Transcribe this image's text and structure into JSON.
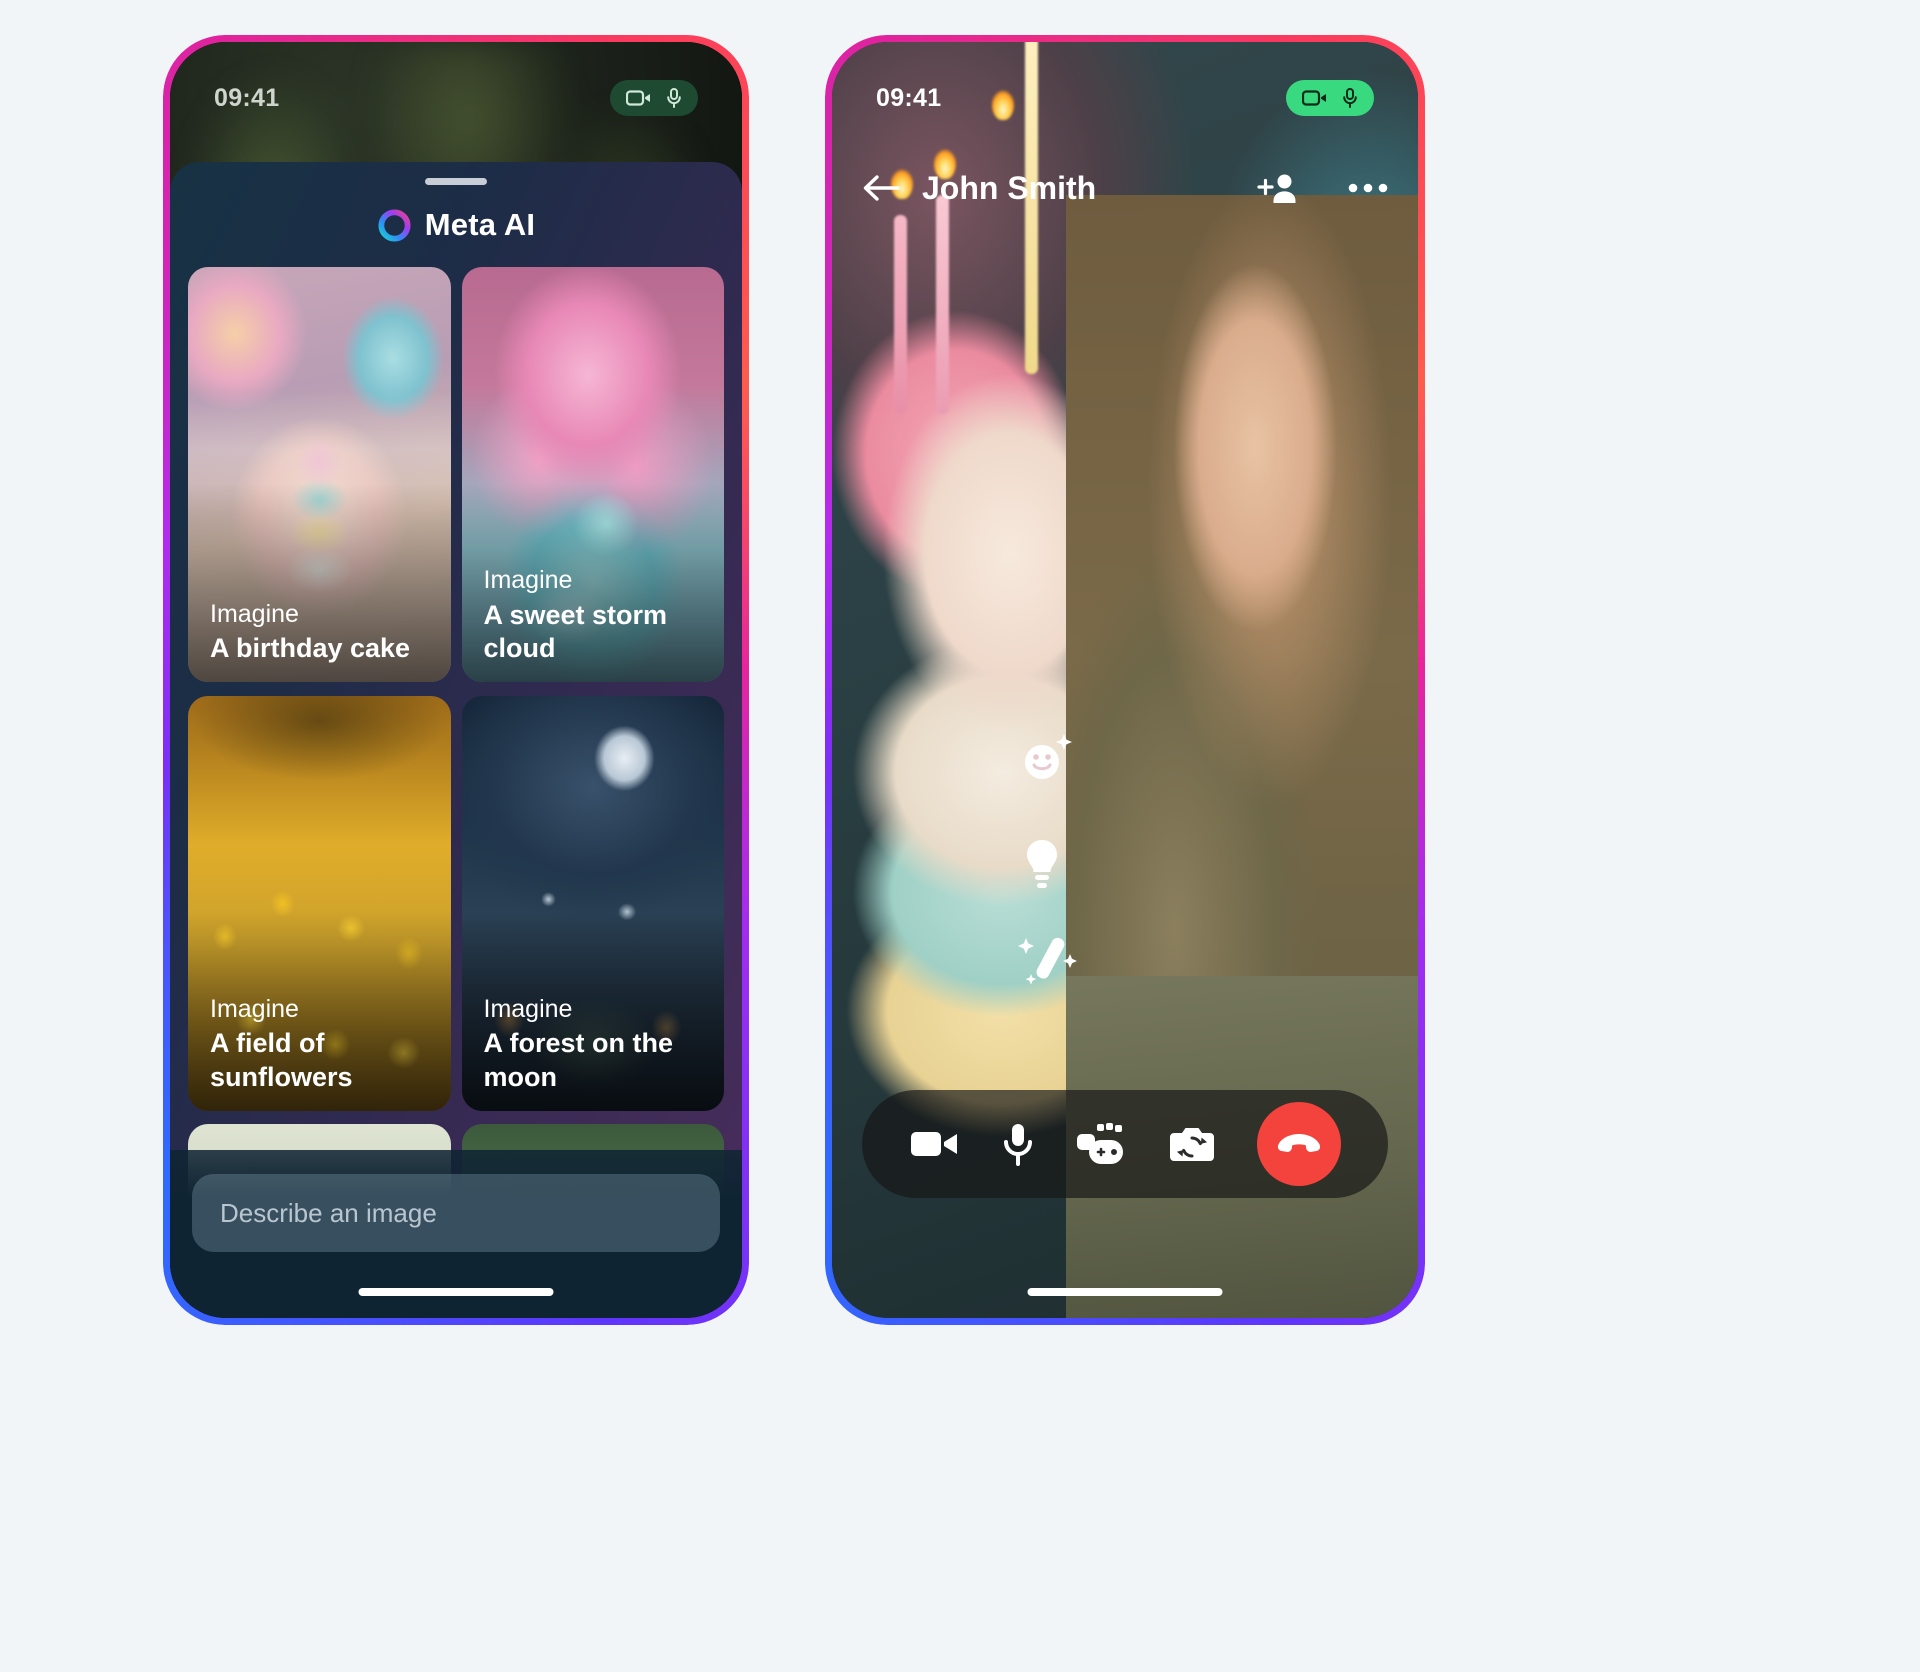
{
  "left_phone": {
    "status_bar": {
      "clock": "09:41",
      "recording_pill": {
        "video_icon": "video-camera-icon",
        "mic_icon": "microphone-icon",
        "state": "active"
      }
    },
    "sheet": {
      "grabber": "drag-handle",
      "title": "Meta AI",
      "logo_icon": "meta-ai-ring-icon",
      "cards": [
        {
          "kicker": "Imagine",
          "title": "A birthday cake",
          "art": "art-cake"
        },
        {
          "kicker": "Imagine",
          "title": "A sweet storm cloud",
          "art": "art-cloud"
        },
        {
          "kicker": "Imagine",
          "title": "A field of sunflowers",
          "art": "art-sun"
        },
        {
          "kicker": "Imagine",
          "title": "A forest on the moon",
          "art": "art-moon"
        },
        {
          "kicker": "",
          "title": "",
          "art": "art-bunny"
        },
        {
          "kicker": "",
          "title": "",
          "art": "art-bug"
        }
      ],
      "composer": {
        "placeholder": "Describe an image",
        "value": ""
      }
    },
    "home_indicator": "home-indicator"
  },
  "right_phone": {
    "status_bar": {
      "clock": "09:41",
      "recording_pill": {
        "video_icon": "video-camera-icon",
        "mic_icon": "microphone-icon",
        "state": "active"
      }
    },
    "call_header": {
      "back_icon": "back-arrow-icon",
      "contact_name": "John Smith",
      "add_person_icon": "add-person-icon",
      "more_icon": "more-options-icon"
    },
    "ar_overlay": [
      {
        "icon": "smiley-face-icon"
      },
      {
        "icon": "lightbulb-icon"
      },
      {
        "icon": "magic-wand-icon"
      }
    ],
    "call_controls": [
      {
        "icon": "video-camera-icon",
        "name": "toggle-video-button"
      },
      {
        "icon": "microphone-icon",
        "name": "toggle-mic-button"
      },
      {
        "icon": "effects-icon",
        "name": "effects-button"
      },
      {
        "icon": "flip-camera-icon",
        "name": "flip-camera-button"
      },
      {
        "icon": "end-call-icon",
        "name": "end-call-button"
      }
    ],
    "home_indicator": "home-indicator"
  },
  "colors": {
    "page_background": "#f2f5f8",
    "frame_gradient_start": "#2f6bff",
    "frame_gradient_mid": "#b32bf0",
    "frame_gradient_end": "#fb3a5d",
    "pill_active": "#39d97f",
    "end_call_red": "#f4433c",
    "sheet_gradient_start": "#173244",
    "sheet_gradient_end": "#4a2d5c",
    "composer_fill": "rgba(148,178,196,0.30)",
    "text_primary": "#ffffff",
    "text_placeholder": "#b9c6cf"
  }
}
